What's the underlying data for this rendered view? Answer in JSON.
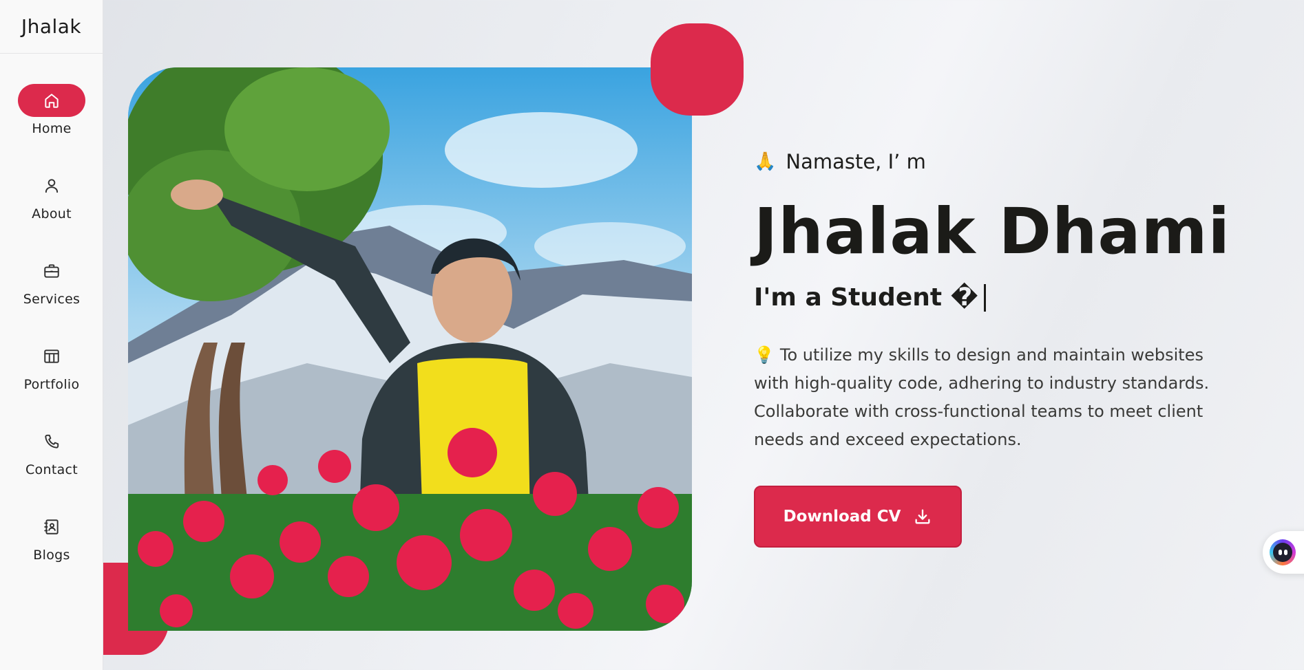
{
  "brand": {
    "name": "Jhalak"
  },
  "nav": {
    "items": [
      {
        "label": "Home",
        "icon": "home-icon",
        "active": true
      },
      {
        "label": "About",
        "icon": "user-icon",
        "active": false
      },
      {
        "label": "Services",
        "icon": "briefcase-icon",
        "active": false
      },
      {
        "label": "Portfolio",
        "icon": "columns-icon",
        "active": false
      },
      {
        "label": "Contact",
        "icon": "phone-icon",
        "active": false
      },
      {
        "label": "Blogs",
        "icon": "address-book-icon",
        "active": false
      }
    ]
  },
  "hero": {
    "greeting_emoji": "🙏",
    "greeting": "Namaste, I’ m",
    "name": "Jhalak Dhami",
    "role": "I'm a Student �",
    "description_emoji": "💡",
    "description": "To utilize my skills to design and maintain websites with high-quality code, adhering to industry standards. Collaborate with cross-functional teams to meet client needs and exceed expectations.",
    "cta_label": "Download CV",
    "cta_icon": "download-icon"
  },
  "colors": {
    "accent": "#dc2a4c",
    "text": "#1b1b18"
  },
  "chat_widget": {
    "icon": "chatbot-face-icon"
  }
}
